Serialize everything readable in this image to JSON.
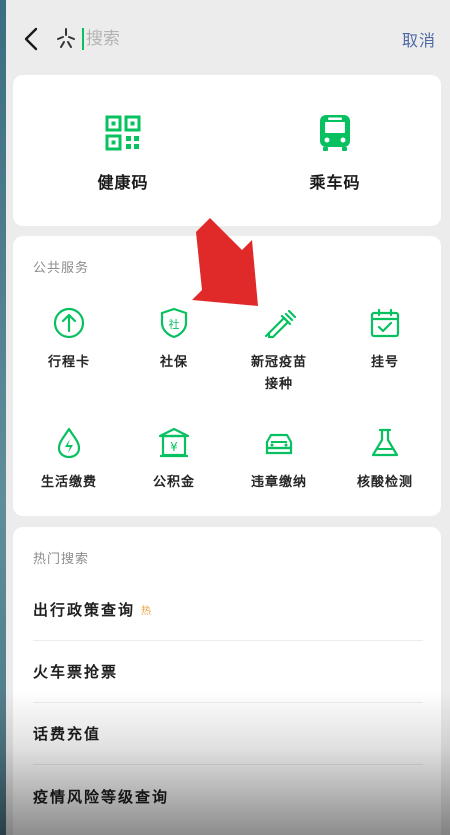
{
  "header": {
    "back_icon": "chevron-left-icon",
    "logo_icon": "sparkle-logo-icon",
    "search_placeholder": "搜索",
    "cancel_label": "取消"
  },
  "codes": [
    {
      "label": "健康码",
      "icon": "qr-code-icon"
    },
    {
      "label": "乘车码",
      "icon": "bus-icon"
    }
  ],
  "public_services": {
    "title": "公共服务",
    "items": [
      {
        "label": "行程卡",
        "icon": "arrow-up-circle-icon"
      },
      {
        "label": "社保",
        "icon": "shield-social-icon"
      },
      {
        "label_line1": "新冠疫苗",
        "label_line2": "接种",
        "icon": "syringe-icon"
      },
      {
        "label": "挂号",
        "icon": "calendar-check-icon"
      },
      {
        "label": "生活缴费",
        "icon": "water-drop-bolt-icon"
      },
      {
        "label": "公积金",
        "icon": "bank-yuan-icon"
      },
      {
        "label": "违章缴纳",
        "icon": "car-icon"
      },
      {
        "label": "核酸检测",
        "icon": "flask-icon"
      }
    ]
  },
  "hot_search": {
    "title": "热门搜索",
    "hot_badge": "热",
    "items": [
      "出行政策查询",
      "火车票抢票",
      "话费充值",
      "疫情风险等级查询"
    ]
  },
  "colors": {
    "accent_green": "#07c160",
    "cancel_blue": "#4e6aa6",
    "arrow_red": "#e02a2a"
  }
}
